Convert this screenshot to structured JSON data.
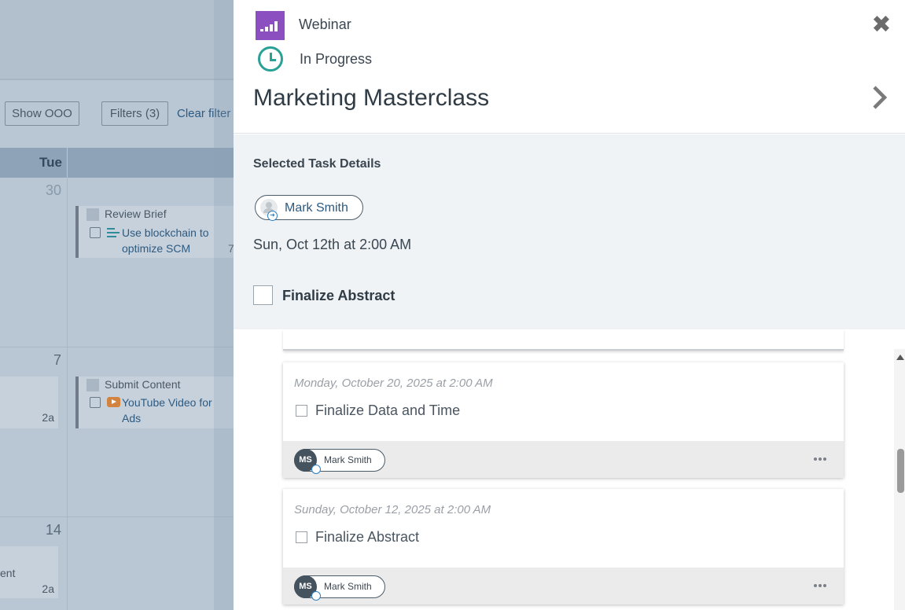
{
  "background": {
    "buttons": {
      "show_ooo": "Show OOO",
      "filters": "Filters (3)",
      "clear_filters": "Clear filter"
    },
    "day_header": "Tue",
    "day_numbers": [
      "30",
      "7",
      "14"
    ],
    "cards": [
      {
        "assignee": "Review Brief",
        "title_line1": "Use blockchain to",
        "title_line2": "optimize SCM",
        "trailing": "7"
      },
      {
        "assignee": "Submit Content",
        "title_line1": "YouTube Video for",
        "title_line2": "Ads"
      }
    ],
    "side_times": [
      "2a",
      "2a"
    ],
    "side_text": "ent"
  },
  "panel": {
    "type_label": "Webinar",
    "status_label": "In Progress",
    "title": "Marketing Masterclass",
    "close_glyph": "✖",
    "details": {
      "heading": "Selected Task Details",
      "assignee": "Mark Smith",
      "due": "Sun, Oct 12th at 2:00 AM",
      "task_name": "Finalize Abstract"
    },
    "tasks": [
      {
        "date": "Monday, October 20, 2025 at 2:00 AM",
        "name": "Finalize Data and Time",
        "assignee_initials": "MS",
        "assignee": "Mark Smith"
      },
      {
        "date": "Sunday, October 12, 2025 at 2:00 AM",
        "name": "Finalize Abstract",
        "assignee_initials": "MS",
        "assignee": "Mark Smith"
      }
    ]
  },
  "colors": {
    "type_icon": "#8c4fc0",
    "status_icon": "#2aa195",
    "link": "#2d5a80",
    "details_bg": "#eff3f5"
  },
  "icons": [
    "webinar-type-icon",
    "clock-icon",
    "close-icon",
    "chevron-right-icon",
    "person-icon",
    "arrow-badge-icon",
    "ellipsis-icon"
  ]
}
